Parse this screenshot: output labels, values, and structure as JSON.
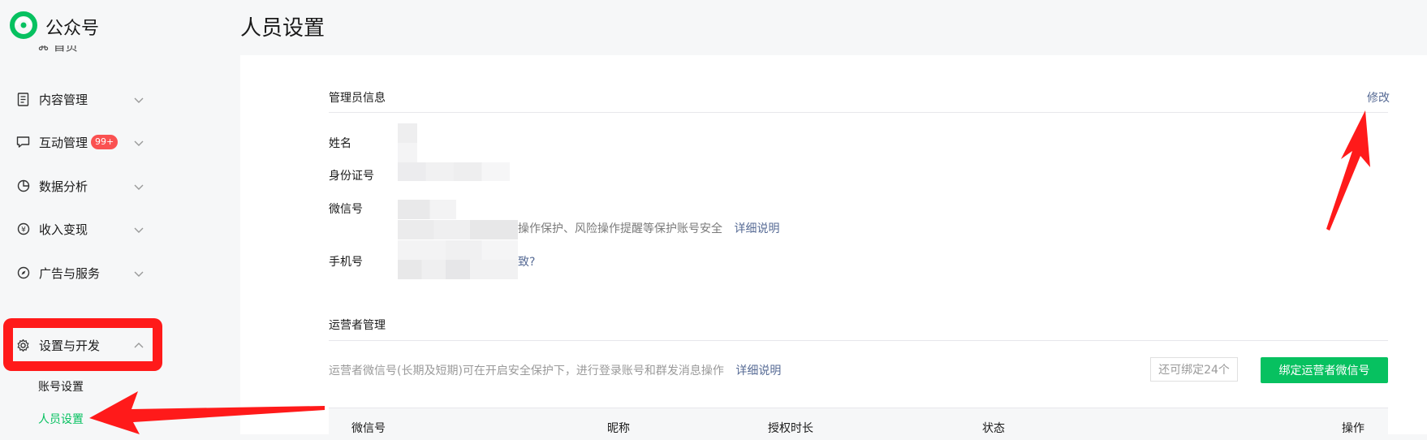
{
  "app": {
    "name": "公众号",
    "page_title": "人员设置"
  },
  "sidebar": {
    "items": [
      {
        "label": "内容管理",
        "icon": "document-icon"
      },
      {
        "label": "互动管理",
        "icon": "chat-bubble-icon",
        "badge": "99+"
      },
      {
        "label": "数据分析",
        "icon": "pie-chart-icon"
      },
      {
        "label": "收入变现",
        "icon": "yen-coin-icon"
      },
      {
        "label": "广告与服务",
        "icon": "compass-icon"
      },
      {
        "label": "设置与开发",
        "icon": "gear-icon",
        "expanded": true
      }
    ],
    "sub_items": [
      {
        "label": "账号设置",
        "active": false
      },
      {
        "label": "人员设置",
        "active": true
      }
    ]
  },
  "admin_section": {
    "title": "管理员信息",
    "edit_label": "修改",
    "name_label": "姓名",
    "id_label": "身份证号",
    "wechat_label": "微信号",
    "wechat_hint": "操作保护、风险操作提醒等保护账号安全",
    "wechat_hint_link": "详细说明",
    "phone_label": "手机号",
    "phone_link": "致?"
  },
  "operator_section": {
    "title": "运营者管理",
    "hint": "运营者微信号(长期及短期)可在开启安全保护下，进行登录账号和群发消息操作",
    "hint_link": "详细说明",
    "quota": "还可绑定24个",
    "bind_button": "绑定运营者微信号",
    "columns": [
      "微信号",
      "昵称",
      "授权时长",
      "状态",
      "操作"
    ]
  },
  "colors": {
    "brand_green": "#07c160",
    "link_blue": "#576b95",
    "badge_red": "#fa5151",
    "annotation_red": "#ff1a1a"
  }
}
